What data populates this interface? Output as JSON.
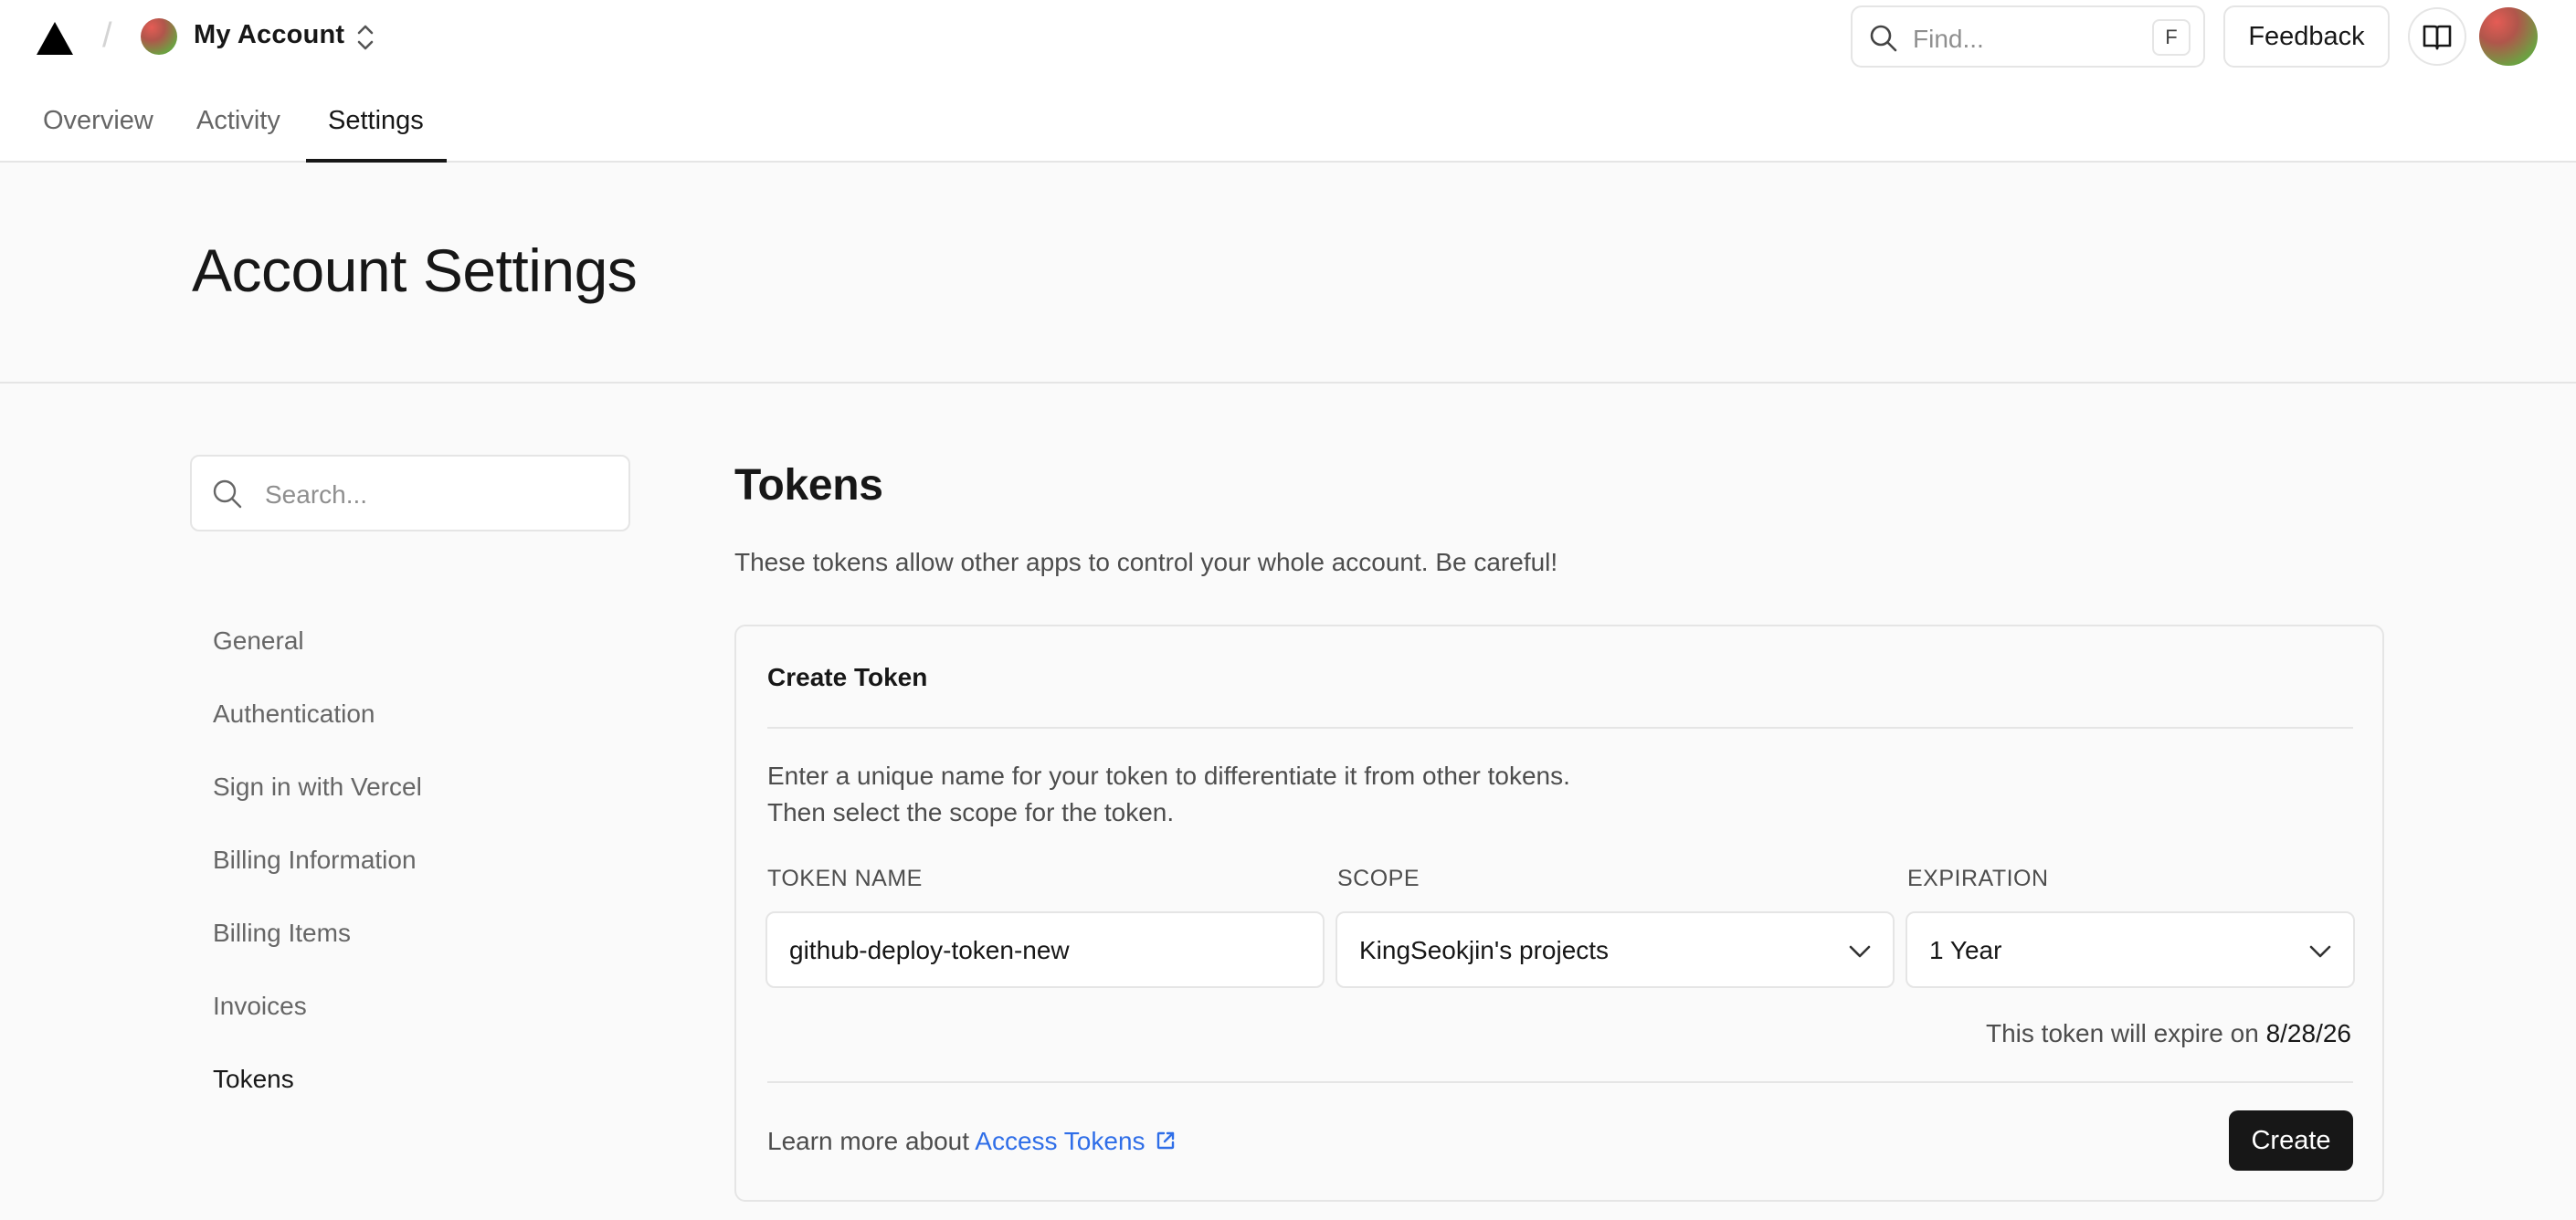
{
  "header": {
    "account_name": "My Account",
    "find_placeholder": "Find...",
    "find_shortcut": "F",
    "feedback_label": "Feedback",
    "icons": {
      "logo": "vercel-triangle-icon",
      "switcher": "chevron-up-down-icon",
      "search": "search-icon",
      "docs": "book-icon"
    }
  },
  "tabs": [
    {
      "label": "Overview",
      "active": false
    },
    {
      "label": "Activity",
      "active": false
    },
    {
      "label": "Settings",
      "active": true
    }
  ],
  "page": {
    "title": "Account Settings"
  },
  "sidebar": {
    "search_placeholder": "Search...",
    "items": [
      {
        "label": "General",
        "active": false
      },
      {
        "label": "Authentication",
        "active": false
      },
      {
        "label": "Sign in with Vercel",
        "active": false
      },
      {
        "label": "Billing Information",
        "active": false
      },
      {
        "label": "Billing Items",
        "active": false
      },
      {
        "label": "Invoices",
        "active": false
      },
      {
        "label": "Tokens",
        "active": true
      }
    ]
  },
  "tokens": {
    "title": "Tokens",
    "description": "These tokens allow other apps to control your whole account. Be careful!",
    "create_card": {
      "title": "Create Token",
      "description_line1": "Enter a unique name for your token to differentiate it from other tokens.",
      "description_line2": "Then select the scope for the token.",
      "token_name_label": "TOKEN NAME",
      "token_name_value": "github-deploy-token-new",
      "scope_label": "SCOPE",
      "scope_value": "KingSeokjin's projects",
      "expiration_label": "EXPIRATION",
      "expiration_value": "1 Year",
      "expire_note_prefix": "This token will expire on",
      "expire_date": "8/28/26",
      "learn_prefix": "Learn more about",
      "learn_link": "Access Tokens",
      "create_label": "Create"
    }
  },
  "colors": {
    "accent_link": "#2f6ee8",
    "primary_button": "#171717",
    "page_background": "#fafafa",
    "border": "#e5e5e5"
  }
}
